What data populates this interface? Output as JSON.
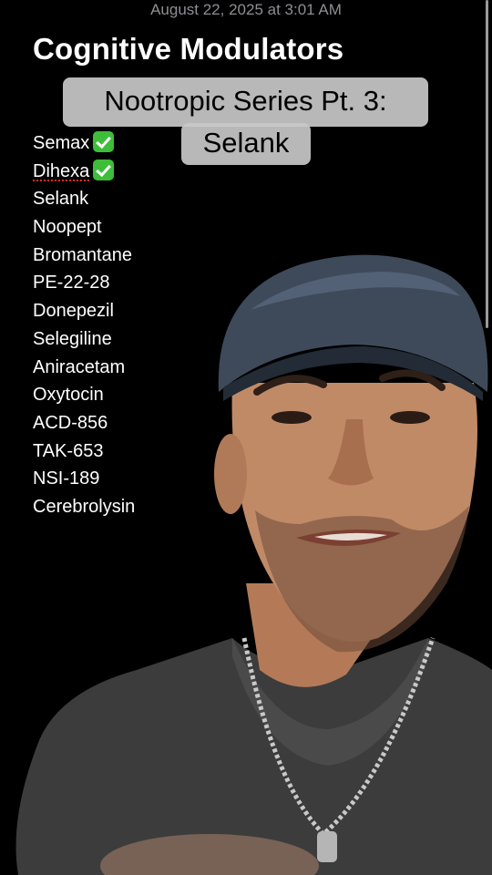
{
  "note": {
    "timestamp": "August 22, 2025 at 3:01 AM",
    "title": "Cognitive Modulators",
    "items": [
      {
        "label": "Semax",
        "checked": true
      },
      {
        "label": "Dihexa",
        "checked": true,
        "spellcheck_flag": true
      },
      {
        "label": "Selank",
        "checked": false
      },
      {
        "label": "Noopept",
        "checked": false
      },
      {
        "label": "Bromantane",
        "checked": false
      },
      {
        "label": "PE-22-28",
        "checked": false
      },
      {
        "label": "Donepezil",
        "checked": false
      },
      {
        "label": "Selegiline",
        "checked": false
      },
      {
        "label": "Aniracetam",
        "checked": false
      },
      {
        "label": "Oxytocin",
        "checked": false
      },
      {
        "label": "ACD-856",
        "checked": false
      },
      {
        "label": "TAK-653",
        "checked": false
      },
      {
        "label": "NSI-189",
        "checked": false
      },
      {
        "label": "Cerebrolysin",
        "checked": false
      }
    ]
  },
  "caption": {
    "line1": "Nootropic Series Pt. 3:",
    "line2": "Selank"
  },
  "icons": {
    "check": "white-heavy-check-mark-icon"
  },
  "colors": {
    "background": "#000000",
    "timestamp": "#8e8e93",
    "check_green": "#3ebd3a",
    "caption_bg": "#c8c8c8",
    "spellcheck_underline": "#e0301e"
  }
}
